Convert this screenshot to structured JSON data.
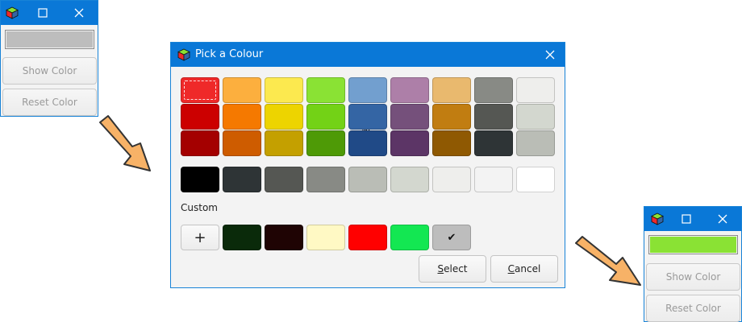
{
  "left_window": {
    "entry_color": "#bdbdbd",
    "show_color_label": "Show Color",
    "reset_color_label": "Reset Color"
  },
  "dialog": {
    "title": "Pick a Colour",
    "palette_rows": [
      [
        "#ef2929",
        "#fcaf3e",
        "#fce94f",
        "#8ae234",
        "#729fcf",
        "#ad7fa8",
        "#e9b96e",
        "#888a85",
        "#eeeeec"
      ],
      [
        "#cc0000",
        "#f57900",
        "#edd400",
        "#73d216",
        "#3465a4",
        "#75507b",
        "#c17d11",
        "#555753",
        "#d3d7cf"
      ],
      [
        "#a40000",
        "#ce5c00",
        "#c4a000",
        "#4e9a06",
        "#204a87",
        "#5c3566",
        "#8f5902",
        "#2e3436",
        "#babdb6"
      ]
    ],
    "selected_swatch": "#ef2929",
    "grays": [
      "#000000",
      "#2e3436",
      "#555753",
      "#888a85",
      "#babdb6",
      "#d3d7cf",
      "#eeeeec",
      "#f3f3f3",
      "#ffffff"
    ],
    "custom_label": "Custom",
    "add_glyph": "+",
    "custom_colors": [
      "#0a2a0a",
      "#1f0404",
      "#fff9c4",
      "#ff0000",
      "#13e752",
      "#bdbdbd"
    ],
    "selected_custom_check": "✔",
    "select_mnemonic": "S",
    "select_rest": "elect",
    "cancel_mnemonic": "C",
    "cancel_rest": "ancel"
  },
  "right_window": {
    "entry_color": "#8ae234",
    "show_color_label": "Show Color",
    "reset_color_label": "Reset Color"
  },
  "colors": {
    "titlebar": "#0a78d7",
    "arrow_fill": "#f7b267",
    "arrow_stroke": "#333333"
  }
}
